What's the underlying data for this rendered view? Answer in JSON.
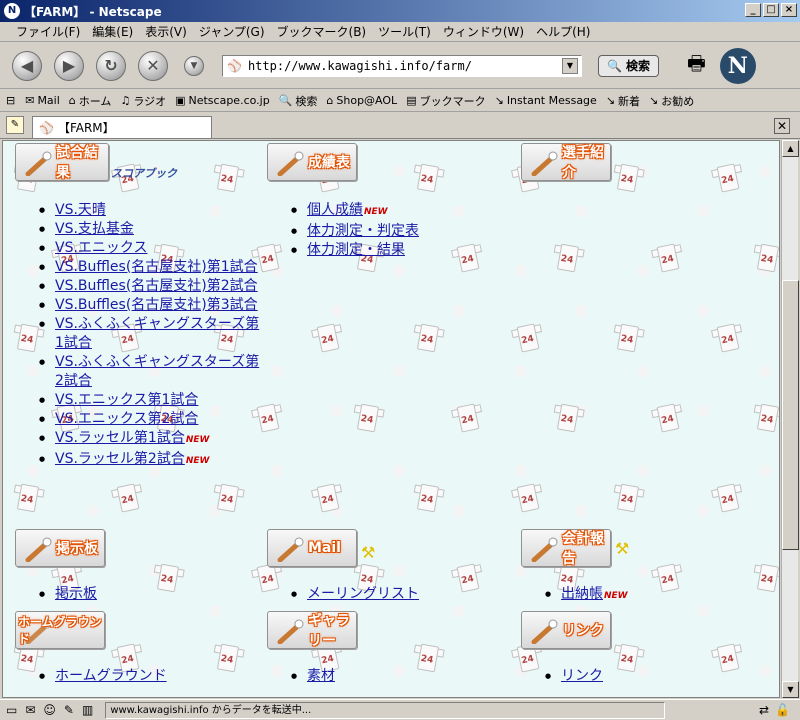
{
  "window": {
    "title": "【FARM】 - Netscape",
    "app_icon": "N"
  },
  "menu": [
    "ファイル(F)",
    "編集(E)",
    "表示(V)",
    "ジャンプ(G)",
    "ブックマーク(B)",
    "ツール(T)",
    "ウィンドウ(W)",
    "ヘルプ(H)"
  ],
  "nav": {
    "url": "http://www.kawagishi.info/farm/",
    "search_label": "検索"
  },
  "personal": [
    "Mail",
    "ホーム",
    "ラジオ",
    "Netscape.co.jp",
    "検索",
    "Shop@AOL",
    "ブックマーク",
    "Instant Message",
    "新着",
    "お勧め"
  ],
  "tab": {
    "label": "【FARM】"
  },
  "page": {
    "new_badge": "NEW",
    "scorebook": "スコアブック",
    "sections": [
      {
        "label": "試合結果",
        "links": [
          "VS.天晴",
          "VS.支払基金",
          "VS.エニックス",
          "VS.Buffles(名古屋支社)第1試合",
          "VS.Buffles(名古屋支社)第2試合",
          "VS.Buffles(名古屋支社)第3試合",
          "VS.ふくふくギャングスターズ第1試合",
          "VS.ふくふくギャングスターズ第2試合",
          "VS.エニックス第1試合",
          "VS.エニックス第2試合",
          "VS.ラッセル第1試合",
          "VS.ラッセル第2試合"
        ]
      },
      {
        "label": "成績表",
        "links": [
          "個人成績",
          "体力測定・判定表",
          "体力測定・結果"
        ]
      },
      {
        "label": "選手紹介",
        "links": []
      },
      {
        "label": "掲示板",
        "links": [
          "掲示板"
        ]
      },
      {
        "label": "Mail",
        "links": [
          "メーリングリスト"
        ]
      },
      {
        "label": "会計報告",
        "links": [
          "出納帳"
        ]
      },
      {
        "label": "ホームグラウンド",
        "links": [
          "ホームグラウンド"
        ]
      },
      {
        "label": "ギャラリー",
        "links": [
          "素材"
        ]
      },
      {
        "label": "リンク",
        "links": [
          "リンク"
        ]
      }
    ]
  },
  "status": {
    "text": "www.kawagishi.info からデータを転送中..."
  }
}
